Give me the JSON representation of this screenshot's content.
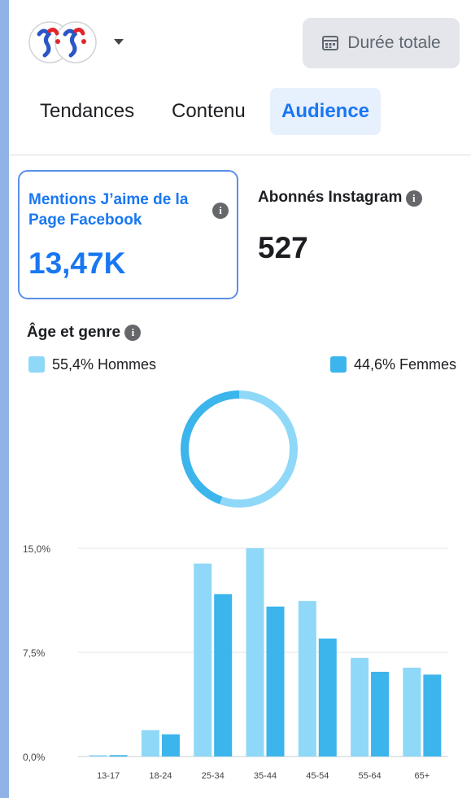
{
  "header": {
    "duration_label": "Durée totale",
    "duration_icon": "calendar-icon"
  },
  "tabs": [
    {
      "label": "Tendances",
      "active": false
    },
    {
      "label": "Contenu",
      "active": false
    },
    {
      "label": "Audience",
      "active": true
    }
  ],
  "stats": {
    "facebook": {
      "label": "Mentions J’aime de la Page Facebook",
      "value": "13,47K"
    },
    "instagram": {
      "label": "Abonnés Instagram",
      "value": "527"
    }
  },
  "section": {
    "title": "Âge et genre"
  },
  "legend": {
    "men": {
      "label": "55,4% Hommes",
      "color": "#8fd8f7"
    },
    "women": {
      "label": "44,6% Femmes",
      "color": "#3cb4ec"
    }
  },
  "chart_data": [
    {
      "type": "pie",
      "categories": [
        "Hommes",
        "Femmes"
      ],
      "values": [
        55.4,
        44.6
      ],
      "colors": [
        "#8fd8f7",
        "#3cb4ec"
      ]
    },
    {
      "type": "bar",
      "categories": [
        "13-17",
        "18-24",
        "25-34",
        "35-44",
        "45-54",
        "55-64",
        "65+"
      ],
      "series": [
        {
          "name": "Hommes",
          "values": [
            0.1,
            1.9,
            13.9,
            15.0,
            11.2,
            7.1,
            6.4
          ],
          "color": "#8fd8f7"
        },
        {
          "name": "Femmes",
          "values": [
            0.1,
            1.6,
            11.7,
            10.8,
            8.5,
            6.1,
            5.9
          ],
          "color": "#3cb4ec"
        }
      ],
      "ylim": [
        0,
        15
      ],
      "yticks": [
        "0,0%",
        "7,5%",
        "15,0%"
      ],
      "grid": true
    }
  ]
}
